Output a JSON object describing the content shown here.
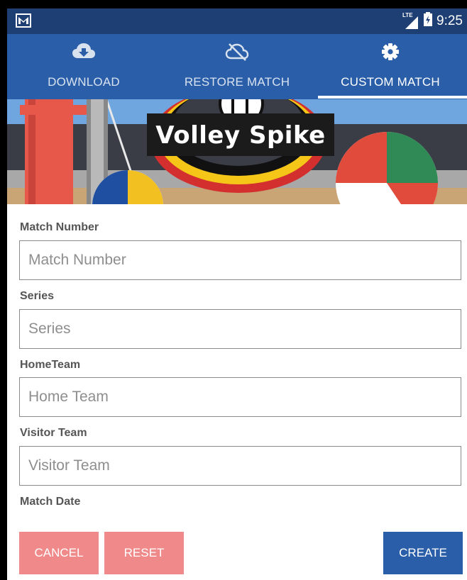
{
  "status_bar": {
    "notification_icon": "gmail-icon",
    "network_label": "LTE",
    "time": "9:25"
  },
  "tabs": [
    {
      "label": "DOWNLOAD",
      "icon": "cloud-download-icon",
      "selected": false
    },
    {
      "label": "RESTORE MATCH",
      "icon": "cloud-off-icon",
      "selected": false
    },
    {
      "label": "CUSTOM MATCH",
      "icon": "gear-icon",
      "selected": true
    }
  ],
  "banner": {
    "title": "Volley Spike"
  },
  "form": {
    "fields": [
      {
        "label": "Match Number",
        "placeholder": "Match Number",
        "value": ""
      },
      {
        "label": "Series",
        "placeholder": "Series",
        "value": ""
      },
      {
        "label": "HomeTeam",
        "placeholder": "Home Team",
        "value": ""
      },
      {
        "label": "Visitor Team",
        "placeholder": "Visitor Team",
        "value": ""
      }
    ],
    "date_label": "Match Date"
  },
  "buttons": {
    "cancel": "CANCEL",
    "reset": "RESET",
    "create": "CREATE"
  },
  "colors": {
    "status_bar": "#1e3f73",
    "app_bar": "#2a5ea8",
    "secondary_button": "#f08a8a",
    "primary_button": "#2a5ea8"
  }
}
